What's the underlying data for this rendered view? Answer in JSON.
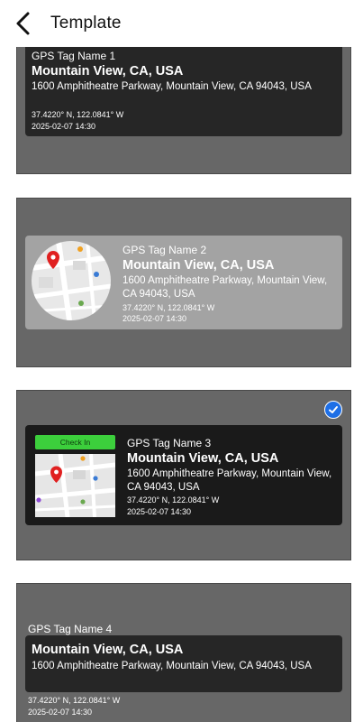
{
  "header": {
    "title": "Template"
  },
  "templates": [
    {
      "tag_name": "GPS Tag Name 1",
      "city": "Mountain View, CA, USA",
      "address": "1600 Amphitheatre Parkway, Mountain View, CA 94043, USA",
      "coords": "37.4220° N, 122.0841° W",
      "datetime": "2025-02-07 14:30"
    },
    {
      "tag_name": "GPS Tag Name 2",
      "city": "Mountain View, CA, USA",
      "address": "1600 Amphitheatre Parkway, Mountain View, CA 94043, USA",
      "coords": "37.4220° N, 122.0841° W",
      "datetime": "2025-02-07 14:30"
    },
    {
      "tag_name": "GPS Tag Name 3",
      "city": "Mountain View, CA, USA",
      "address": "1600 Amphitheatre Parkway, Mountain View, CA 94043, USA",
      "coords": "37.4220° N, 122.0841° W",
      "datetime": "2025-02-07 14:30",
      "badge": "Check In",
      "selected": true
    },
    {
      "tag_name": "GPS Tag Name 4",
      "city": "Mountain View, CA, USA",
      "address": "1600 Amphitheatre Parkway, Mountain View, CA 94043, USA",
      "coords": "37.4220° N, 122.0841° W",
      "datetime": "2025-02-07 14:30"
    }
  ],
  "icons": {
    "back": "chevron-left-icon",
    "selected": "checkmark-icon",
    "map_pin": "location-pin-icon"
  },
  "colors": {
    "card_bg": "#676767",
    "panel_dark": "#262626",
    "panel_light": "#a3a3a3",
    "selected_accent": "#1e6fe6",
    "checkin_green": "#3ccf3c"
  }
}
